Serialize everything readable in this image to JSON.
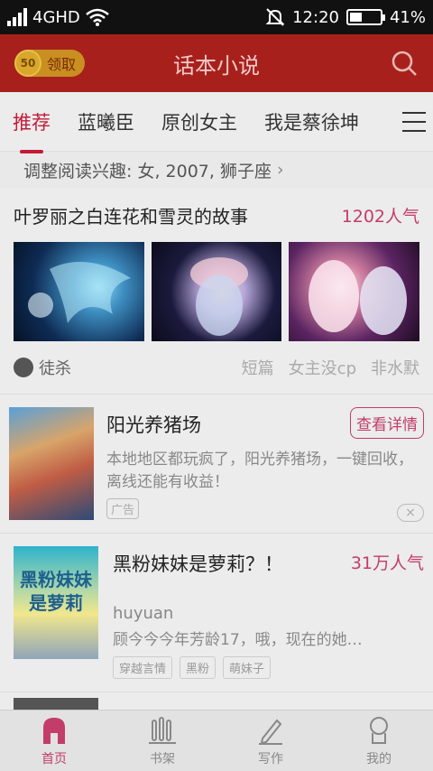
{
  "status": {
    "network": "4GHD",
    "time": "12:20",
    "battery_pct": "41%",
    "battery_level": 0.41
  },
  "header": {
    "coin_value": "50",
    "claim_label": "领取",
    "title": "话本小说",
    "search_icon": "search-icon"
  },
  "tabs": [
    "推荐",
    "蓝曦臣",
    "原创女主",
    "我是蔡徐坤"
  ],
  "interest": {
    "text": "调整阅读兴趣: 女, 2007, 狮子座",
    "chevron": "›"
  },
  "featured": {
    "title": "叶罗丽之白连花和雪灵的故事",
    "popularity": "1202人气",
    "author": "徒杀",
    "tags": [
      "短篇",
      "女主没cp",
      "非水默"
    ]
  },
  "ad": {
    "title": "阳光养猪场",
    "detail_button": "查看详情",
    "desc": "本地地区都玩疯了，阳光养猪场，一键回收，离线还能有收益！",
    "badge": "广告",
    "close": "×"
  },
  "book": {
    "cover_text": "黑粉妹妹是萝莉",
    "title": "黑粉妹妹是萝莉？！",
    "popularity": "31万人气",
    "author": "huyuan",
    "summary": "顾今今今年芳龄17，哦，现在的她…",
    "tags": [
      "穿越言情",
      "黑粉",
      "萌妹子"
    ]
  },
  "nav": {
    "home": "首页",
    "shelf": "书架",
    "write": "写作",
    "mine": "我的"
  },
  "colors": {
    "accent": "#c23d69",
    "header_bg": "#a8201c"
  }
}
